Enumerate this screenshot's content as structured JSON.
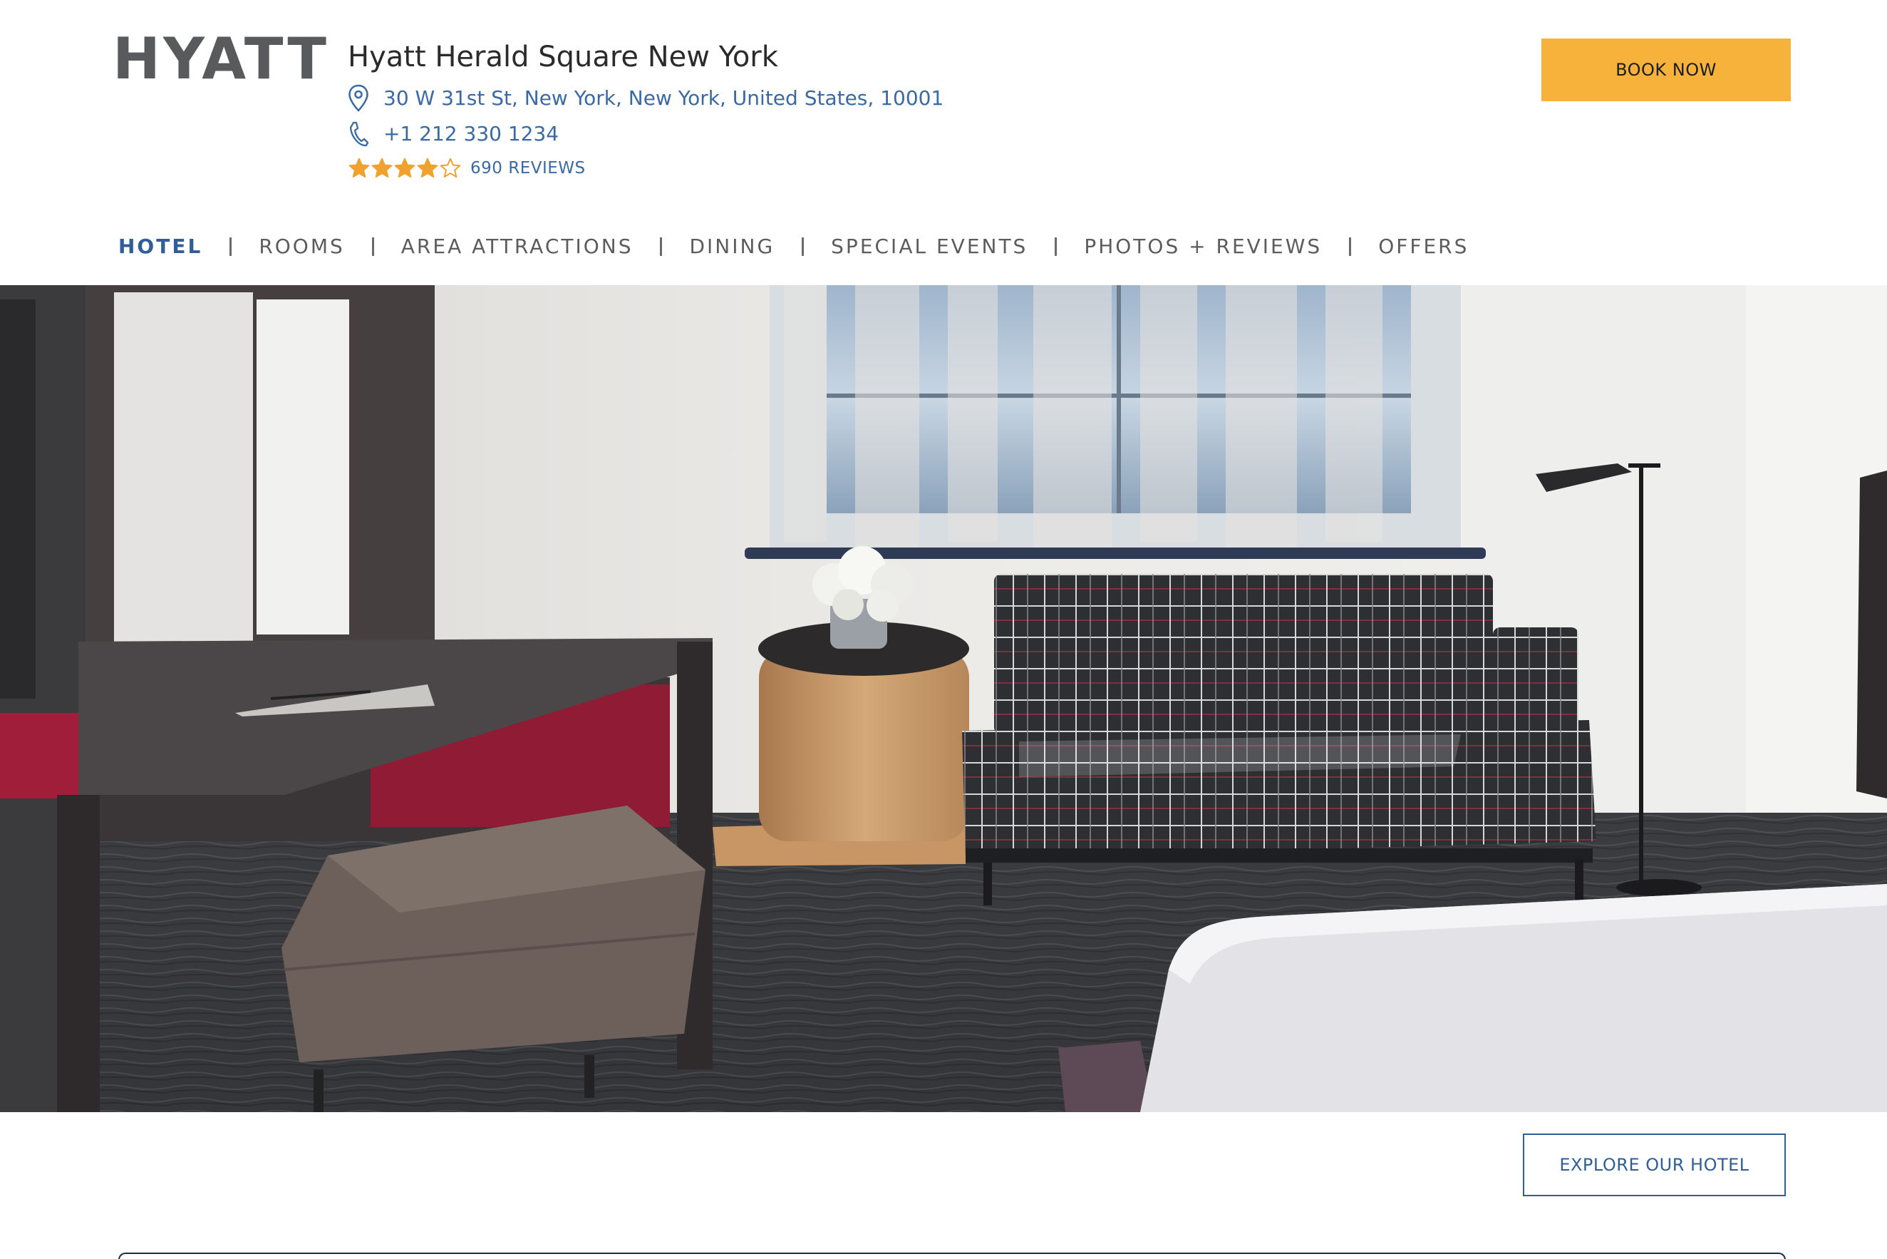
{
  "brand": {
    "logo_text": "HYATT",
    "registered_mark": "®",
    "text_color": "#595a5c"
  },
  "hotel": {
    "name": "Hyatt Herald Square New York",
    "address": "30 W 31st St, New York, New York, United States, 10001",
    "phone": "+1 212 330 1234",
    "rating": 4,
    "rating_max": 5,
    "reviews_label": "690 REVIEWS"
  },
  "header": {
    "book_now_label": "BOOK NOW"
  },
  "nav": {
    "items": [
      {
        "label": "HOTEL",
        "active": true
      },
      {
        "label": "ROOMS",
        "active": false
      },
      {
        "label": "AREA ATTRACTIONS",
        "active": false
      },
      {
        "label": "DINING",
        "active": false
      },
      {
        "label": "SPECIAL EVENTS",
        "active": false
      },
      {
        "label": "PHOTOS + REVIEWS",
        "active": false
      },
      {
        "label": "OFFERS",
        "active": false
      }
    ]
  },
  "main": {
    "explore_label": "EXPLORE OUR HOTEL"
  },
  "icons": {
    "address": "map-pin-icon",
    "phone": "phone-icon",
    "star": "star-icon"
  },
  "colors": {
    "accent_blue": "#2f5f96",
    "link_blue": "#3a6aa3",
    "book_button": "#f6b23a",
    "star": "#f0a22e"
  }
}
